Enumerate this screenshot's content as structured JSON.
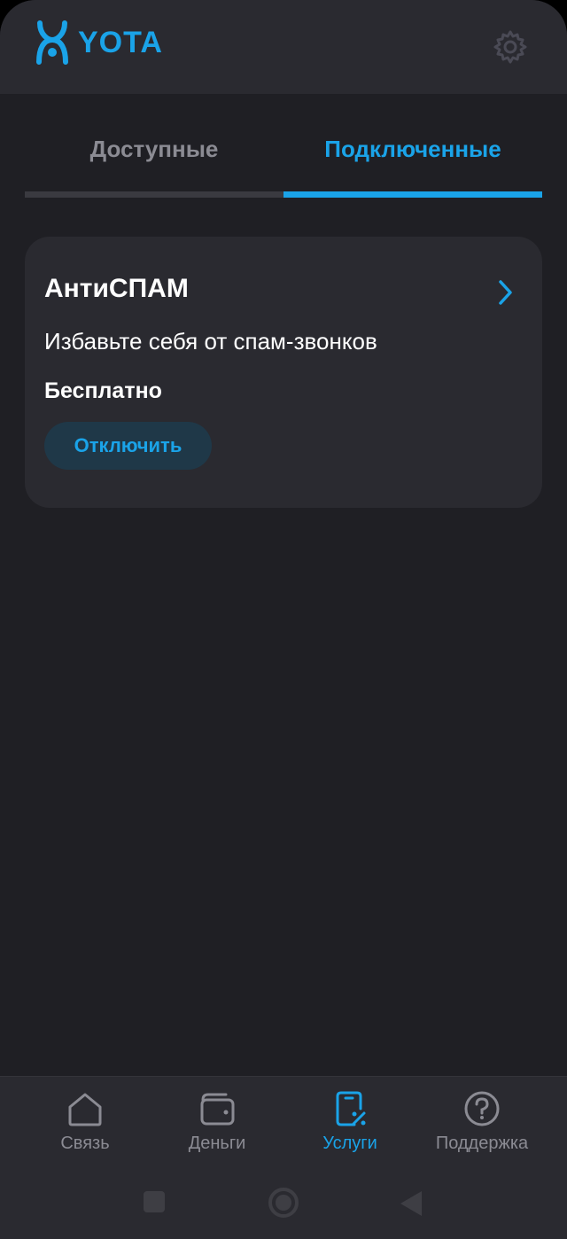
{
  "header": {
    "logo_text": "YOTA",
    "logo_icon": "yota-logo-icon",
    "settings_icon": "gear-icon"
  },
  "tabs": [
    {
      "label": "Доступные",
      "active": false
    },
    {
      "label": "Подключенные",
      "active": true
    }
  ],
  "service_card": {
    "title": "АнтиСПАМ",
    "description": "Избавьте себя от спам-звонков",
    "price": "Бесплатно",
    "action_label": "Отключить",
    "chevron_icon": "chevron-right-icon"
  },
  "bottom_nav": [
    {
      "label": "Связь",
      "icon": "home-icon",
      "active": false
    },
    {
      "label": "Деньги",
      "icon": "wallet-icon",
      "active": false
    },
    {
      "label": "Услуги",
      "icon": "services-percent-icon",
      "active": true
    },
    {
      "label": "Поддержка",
      "icon": "help-icon",
      "active": false
    }
  ],
  "system_nav": [
    "recent-apps-icon",
    "home-circle-icon",
    "back-icon"
  ],
  "colors": {
    "accent": "#1aa3e8",
    "background": "#1f1f24",
    "surface": "#2a2a30",
    "muted_text": "#8b8b93"
  }
}
